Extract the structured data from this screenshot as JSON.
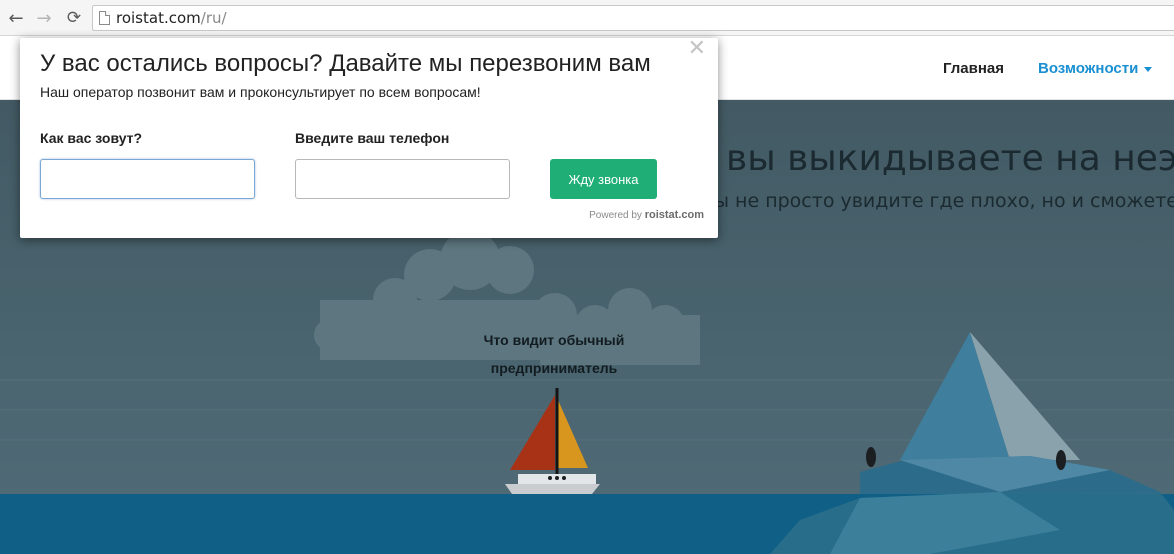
{
  "browser": {
    "url_host": "roistat.com",
    "url_path": "/ru/",
    "back_glyph": "←",
    "forward_glyph": "→",
    "reload_glyph": "⟳"
  },
  "site": {
    "nav": {
      "home": "Главная",
      "features": "Возможности"
    },
    "hero": {
      "title_fragment": "вы выкидываете на неэфф",
      "subtitle_fragment": "ы не просто увидите где плохо, но и сможете на з",
      "scene_caption_line1": "Что видит обычный",
      "scene_caption_line2": "предприниматель"
    }
  },
  "modal": {
    "close_glyph": "✕",
    "title": "У вас остались вопросы? Давайте мы перезвоним вам",
    "subtitle": "Наш оператор позвонит вам и проконсультирует по всем вопросам!",
    "name_label": "Как вас зовут?",
    "name_value": "",
    "phone_label": "Введите ваш телефон",
    "phone_value": "",
    "submit_label": "Жду звонка",
    "powered_prefix": "Powered by",
    "powered_brand": "roistat.com"
  },
  "colors": {
    "accent": "#1a8fd1",
    "button": "#1fae76",
    "sea": "#0f5f86",
    "sail_left": "#a83216",
    "sail_right": "#d8961f"
  }
}
